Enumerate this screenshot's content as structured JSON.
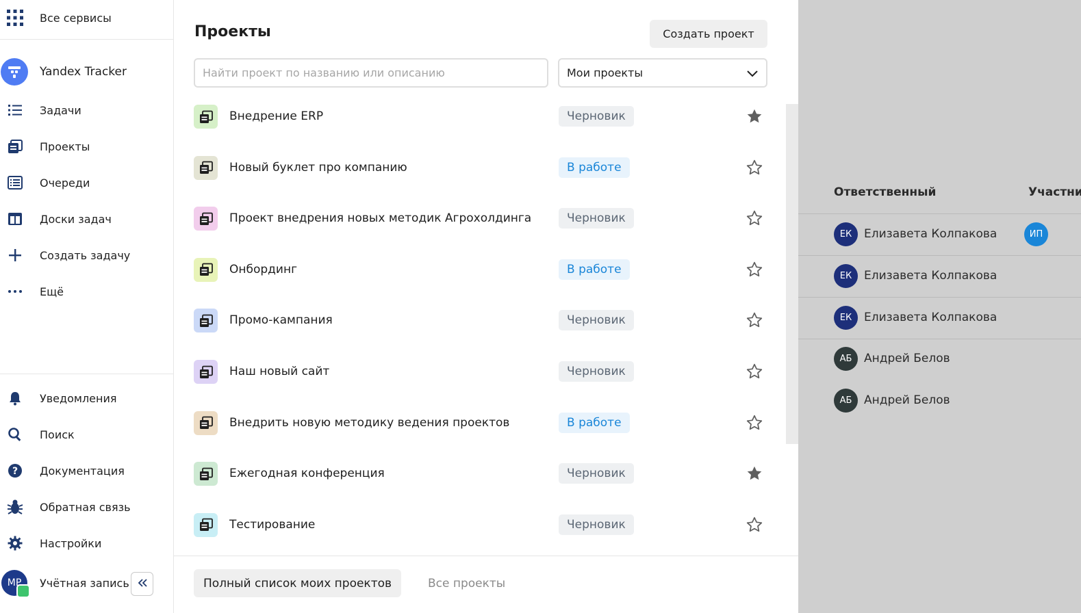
{
  "sidebar": {
    "all_services": "Все сервисы",
    "app_name": "Yandex Tracker",
    "nav": [
      {
        "label": "Задачи",
        "icon": "list-icon"
      },
      {
        "label": "Проекты",
        "icon": "projects-icon"
      },
      {
        "label": "Очереди",
        "icon": "queues-icon"
      },
      {
        "label": "Доски задач",
        "icon": "boards-icon"
      },
      {
        "label": "Создать задачу",
        "icon": "plus-icon"
      },
      {
        "label": "Ещё",
        "icon": "more-icon"
      }
    ],
    "bottom": [
      {
        "label": "Уведомления",
        "icon": "bell-icon"
      },
      {
        "label": "Поиск",
        "icon": "search-icon"
      },
      {
        "label": "Документация",
        "icon": "help-icon"
      },
      {
        "label": "Обратная связь",
        "icon": "bug-icon"
      },
      {
        "label": "Настройки",
        "icon": "gear-icon"
      }
    ],
    "account": {
      "label": "Учётная запись",
      "initials": "МР"
    }
  },
  "panel": {
    "title": "Проекты",
    "create_button": "Создать проект",
    "search_placeholder": "Найти проект по названию или описанию",
    "filter_value": "Мои проекты",
    "projects": [
      {
        "name": "Внедрение ERP",
        "status": "Черновик",
        "status_kind": "draft",
        "starred": true,
        "icon_bg": "#d6f0c8"
      },
      {
        "name": "Новый буклет про компанию",
        "status": "В работе",
        "status_kind": "work",
        "starred": false,
        "icon_bg": "#e4e4d4"
      },
      {
        "name": "Проект внедрения новых методик Агрохолдинга",
        "status": "Черновик",
        "status_kind": "draft",
        "starred": false,
        "icon_bg": "#f2cdec"
      },
      {
        "name": "Онбординг",
        "status": "В работе",
        "status_kind": "work",
        "starred": false,
        "icon_bg": "#e8f3b8"
      },
      {
        "name": "Промо-кампания",
        "status": "Черновик",
        "status_kind": "draft",
        "starred": false,
        "icon_bg": "#cbd9f7"
      },
      {
        "name": "Наш новый сайт",
        "status": "Черновик",
        "status_kind": "draft",
        "starred": false,
        "icon_bg": "#ddd2f5"
      },
      {
        "name": "Внедрить новую методику ведения проектов",
        "status": "В работе",
        "status_kind": "work",
        "starred": false,
        "icon_bg": "#eddcc4"
      },
      {
        "name": "Ежегодная конференция",
        "status": "Черновик",
        "status_kind": "draft",
        "starred": true,
        "icon_bg": "#cde9d2"
      },
      {
        "name": "Тестирование",
        "status": "Черновик",
        "status_kind": "draft",
        "starred": false,
        "icon_bg": "#c8eef5"
      }
    ],
    "full_list_button": "Полный список моих проектов",
    "all_projects_link": "Все проекты"
  },
  "background_table": {
    "headers": [
      "Ответственный",
      "Участни"
    ],
    "rows": [
      {
        "initials": "ЕК",
        "name": "Елизавета Колпакова",
        "avatar_color": "#1d2f7a",
        "participant": "ИП"
      },
      {
        "initials": "ЕК",
        "name": "Елизавета Колпакова",
        "avatar_color": "#1d2f7a",
        "participant": ""
      },
      {
        "initials": "ЕК",
        "name": "Елизавета Колпакова",
        "avatar_color": "#1d2f7a",
        "participant": ""
      },
      {
        "initials": "АБ",
        "name": "Андрей Белов",
        "avatar_color": "#2f3a3a",
        "participant": ""
      },
      {
        "initials": "АБ",
        "name": "Андрей Белов",
        "avatar_color": "#2f3a3a",
        "participant": ""
      }
    ]
  },
  "colors": {
    "accent": "#4f7cf3",
    "status_work": "#1a86d8",
    "status_draft": "#5b6674",
    "backdrop": "#cfcfcf"
  }
}
